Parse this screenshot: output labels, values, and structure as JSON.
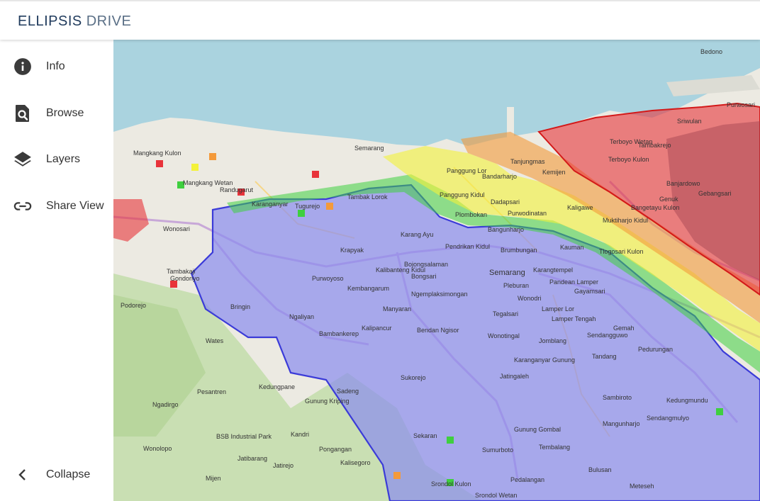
{
  "header": {
    "logo_left": "ELLIPSIS",
    "logo_right": "DRIVE"
  },
  "sidebar": {
    "items": [
      {
        "label": "Info",
        "icon": "info-icon"
      },
      {
        "label": "Browse",
        "icon": "browse-icon"
      },
      {
        "label": "Layers",
        "icon": "layers-icon"
      },
      {
        "label": "Share View",
        "icon": "link-icon"
      }
    ],
    "collapse": {
      "label": "Collapse",
      "icon": "chevron-left-icon"
    }
  },
  "map": {
    "labels": [
      "Bedono",
      "Purwosari",
      "Sriwulan",
      "Terboyo Kulon",
      "Terboyo Wetan",
      "Tambakrejo",
      "Tanjungmas",
      "Mangkang Kulon",
      "Mangkang Wetan",
      "Randugarut",
      "Karanganyar",
      "Tugurejo",
      "Tambak Lorok",
      "Panggung Lor",
      "Bandarharjo",
      "Panggung Kidul",
      "Dadapsari",
      "Plombokan",
      "Purwodinatan",
      "Bangunharjo",
      "Brumbungan",
      "Kauman",
      "Krapyak",
      "Bojongsalaman",
      "Kalibanteng Kidul",
      "Karang Ayu",
      "Semarang",
      "Karangtempel",
      "Kemijen",
      "Kaligawe",
      "Bangetayu Kulon",
      "Muktiharjo Kidul",
      "Tlogosari Kulon",
      "Genuk",
      "Banjardowo",
      "Gebangsari",
      "Tambakaji",
      "Purwoyoso",
      "Bongsari",
      "Kembangarum",
      "Ngemplaksimongan",
      "Pendrikan Kidul",
      "Pleburan",
      "Wonodri",
      "Pandean Lamper",
      "Gayamsari",
      "Lamper Lor",
      "Lamper Tengah",
      "Sendangguwo",
      "Gemah",
      "Pedurungan",
      "Bringin",
      "Ngaliyan",
      "Manyaran",
      "Tegalsari",
      "Jomblang",
      "Tandang",
      "Wates",
      "Bambankerep",
      "Kalipancur",
      "Bendan Ngisor",
      "Wonotingal",
      "Karanganyar Gunung",
      "Podorejo",
      "Pesantren",
      "Ngadirgo",
      "Wonolopo",
      "Mijen",
      "Jatibarang",
      "Kedungpane",
      "Sadeng",
      "Gunung Kriping",
      "Sukorejo",
      "Jatingaleh",
      "Kandri",
      "Pongangan",
      "Kalisegoro",
      "Sekaran",
      "Sumurboto",
      "Srondol Kulon",
      "Pedalangan",
      "Tembalang",
      "Bulusan",
      "Meteseh",
      "Mangunharjo",
      "Sendangmulyo",
      "Kedungmundu",
      "Sambiroto",
      "Wonosari",
      "Gondoriyo",
      "BSB Industrial Park",
      "Jatirejo",
      "Srondol Wetan",
      "Gunung Gombal",
      "Semarang"
    ]
  }
}
